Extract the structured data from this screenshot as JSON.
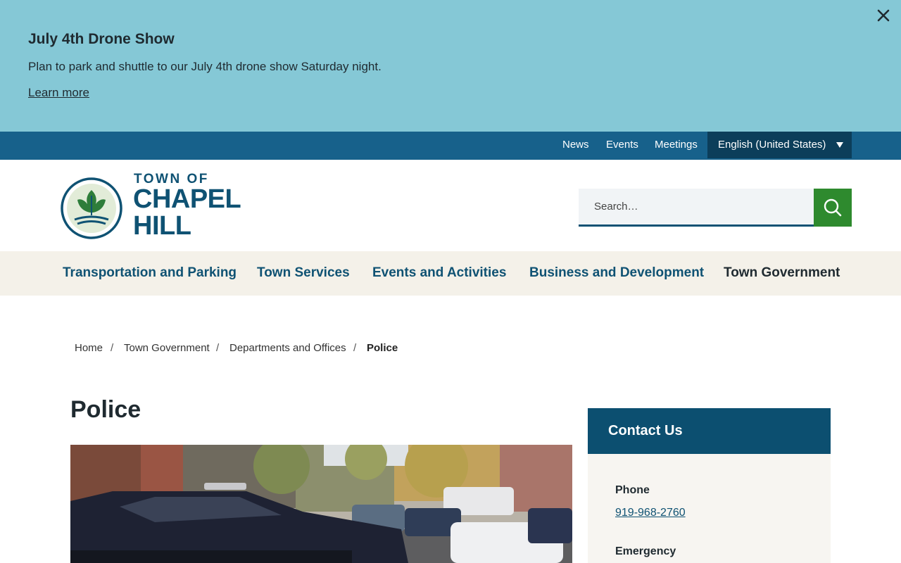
{
  "alert": {
    "title": "July 4th Drone Show",
    "text": "Plan to park and shuttle to our July 4th drone show Saturday night.",
    "link": "Learn more",
    "close_icon": "close-icon",
    "background": "#85c8d6"
  },
  "utility": {
    "links": [
      "News",
      "Events",
      "Meetings"
    ],
    "language": "English (United States)",
    "background": "#17618b"
  },
  "logo": {
    "line1": "TOWN OF",
    "line2": "CHAPEL",
    "line3": "HILL",
    "icon": "tree-emblem-icon"
  },
  "search": {
    "placeholder": "Search…",
    "icon": "search-icon",
    "button_color": "#2e8a2e"
  },
  "nav": {
    "items": [
      "Transportation and Parking",
      "Town Services",
      "Events and Activities",
      "Business and Development",
      "Town Government"
    ]
  },
  "breadcrumb": {
    "items": [
      "Home",
      "Town Government",
      "Departments and Offices"
    ],
    "current": "Police",
    "separator": "/"
  },
  "page": {
    "title": "Police"
  },
  "contact": {
    "title": "Contact Us",
    "phone_label": "Phone",
    "phone": "919-968-2760",
    "emergency_label": "Emergency"
  }
}
